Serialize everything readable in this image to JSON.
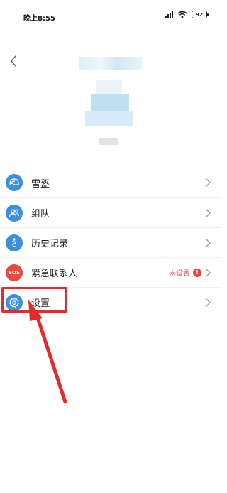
{
  "status_bar": {
    "time": "晚上8:55",
    "battery": "92",
    "icons": [
      "signal-icon",
      "wifi-icon",
      "battery-icon"
    ]
  },
  "header": {
    "back_icon": "chevron-left-icon"
  },
  "menu": {
    "items": [
      {
        "label": "雪盔",
        "icon": "helmet-icon",
        "icon_color": "#3d8fdc"
      },
      {
        "label": "组队",
        "icon": "team-icon",
        "icon_color": "#3d8fdc"
      },
      {
        "label": "历史记录",
        "icon": "history-icon",
        "icon_color": "#3d8fdc"
      },
      {
        "label": "紧急联系人",
        "icon": "sos-icon",
        "icon_text": "SOS",
        "icon_color": "#e64a3f",
        "status": "未设置",
        "badge": "!"
      },
      {
        "label": "设置",
        "icon": "gear-icon",
        "icon_color": "#3d8fdc"
      }
    ]
  },
  "colors": {
    "accent_blue": "#3d8fdc",
    "alert_red": "#e5443c",
    "annotation_red": "#e32b2b"
  }
}
